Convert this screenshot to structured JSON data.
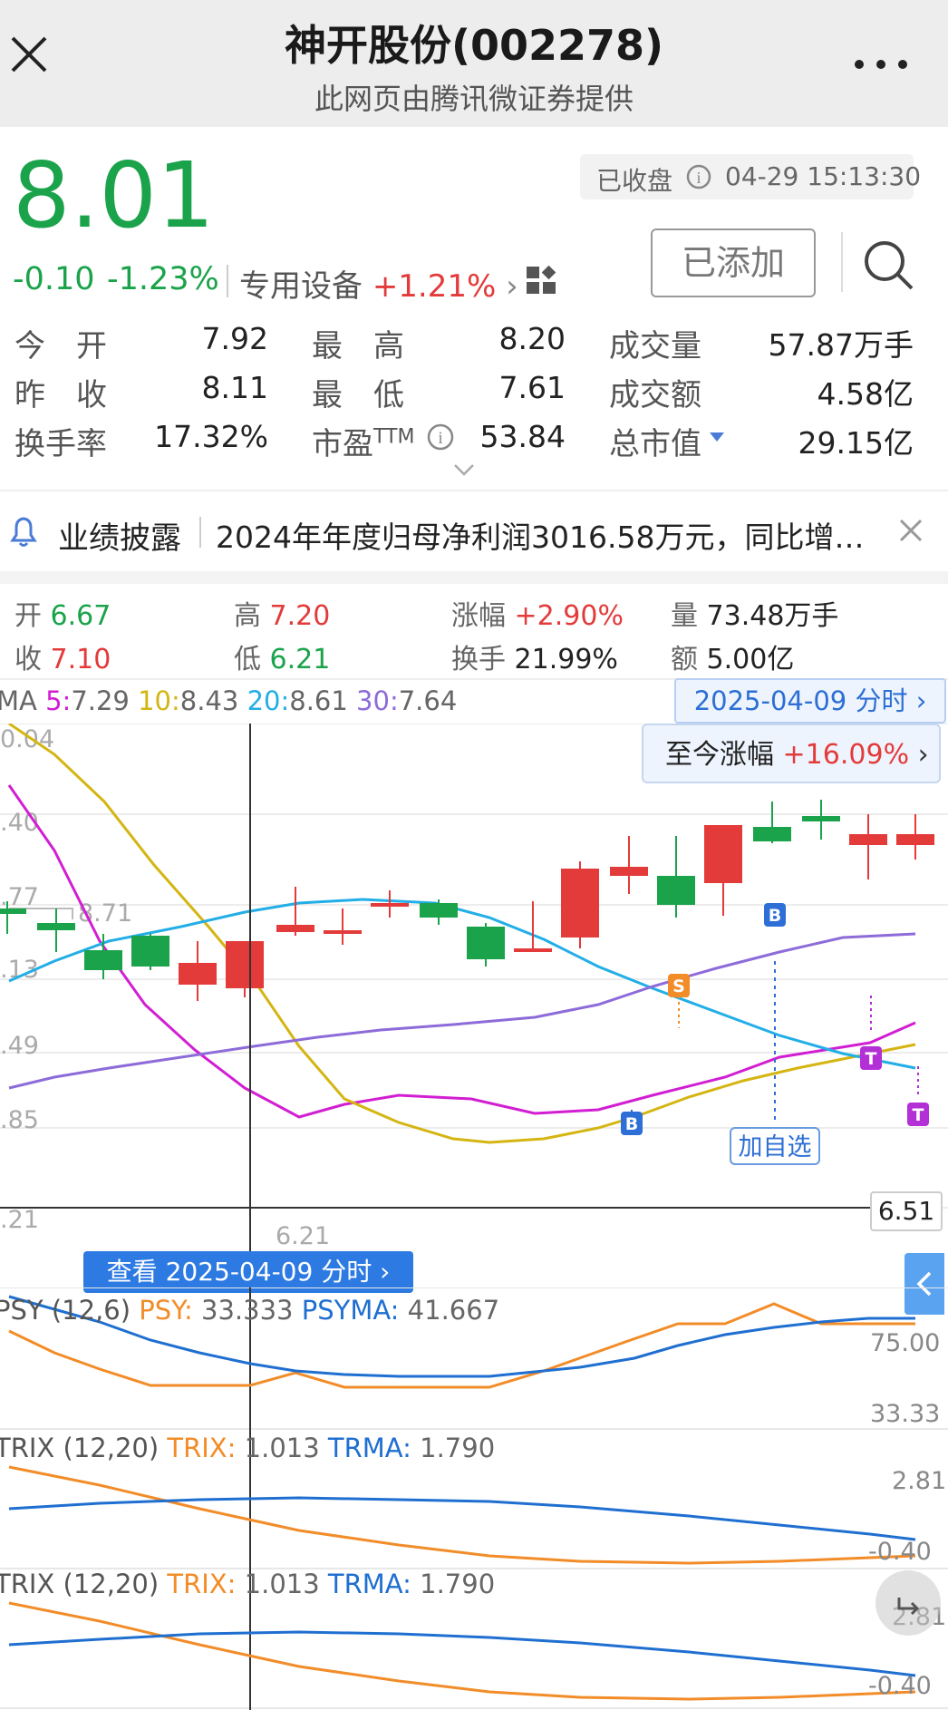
{
  "header": {
    "title": "神开股份(002278)",
    "subtitle": "此网页由腾讯微证券提供"
  },
  "quote": {
    "price": "8.01",
    "change": "-0.10",
    "change_pct": "-1.23%",
    "sector": "专用设备",
    "sector_pct": "+1.21%",
    "status": "已收盘",
    "time": "04-29 15:13:30",
    "added_label": "已添加"
  },
  "stats": [
    {
      "label": "今　开",
      "value": "7.92"
    },
    {
      "label": "最　高",
      "value": "8.20"
    },
    {
      "label": "成交量",
      "value": "57.87万手"
    },
    {
      "label": "昨　收",
      "value": "8.11"
    },
    {
      "label": "最　低",
      "value": "7.61"
    },
    {
      "label": "成交额",
      "value": "4.58亿"
    },
    {
      "label": "换手率",
      "value": "17.32%"
    },
    {
      "label": "市盈",
      "label_sup": "TTM",
      "value": "53.84"
    },
    {
      "label": "总市值",
      "value": "29.15亿"
    }
  ],
  "notice": {
    "tag": "业绩披露",
    "text": "2024年年度归母净利润3016.58万元，同比增…"
  },
  "day": {
    "open_label": "开",
    "open": "6.67",
    "high_label": "高",
    "high": "7.20",
    "chg_label": "涨幅",
    "chg": "+2.90%",
    "vol_label": "量",
    "vol": "73.48万手",
    "close_label": "收",
    "close": "7.10",
    "low_label": "低",
    "low": "6.21",
    "turn_label": "换手",
    "turn": "21.99%",
    "amt_label": "额",
    "amt": "5.00亿"
  },
  "ma": {
    "prefix": "MA",
    "k5": "5:",
    "v5": "7.29",
    "k10": "10:",
    "v10": "8.43",
    "k20": "20:",
    "v20": "8.61",
    "k30": "30:",
    "v30": "7.64"
  },
  "date_btn": "2025-04-09 分时",
  "since": {
    "label": "至今涨幅",
    "value": "+16.09%"
  },
  "axis": {
    "y": [
      "0.04",
      ".40",
      ".77",
      ".13",
      ".49",
      ".85",
      ".21"
    ],
    "hi_mark": "8.71",
    "lo_mark": "6.21",
    "cursor_price": "6.51"
  },
  "markers": {
    "b": "B",
    "s": "S",
    "t": "T",
    "add": "加自选"
  },
  "view_btn": "查看 2025-04-09 分时",
  "psy": {
    "name": "PSY",
    "params": "(12,6)",
    "k": "PSY:",
    "v": "33.333",
    "mk": "PSYMA:",
    "mv": "41.667",
    "ymax": "75.00",
    "ymin": "33.33"
  },
  "trix1": {
    "name": "TRIX",
    "params": "(12,20)",
    "k": "TRIX:",
    "v": "1.013",
    "mk": "TRMA:",
    "mv": "1.790",
    "ymax": "2.81",
    "ymin": "-0.40"
  },
  "trix2": {
    "name": "TRIX",
    "params": "(12,20)",
    "k": "TRIX:",
    "v": "1.013",
    "mk": "TRMA:",
    "mv": "1.790",
    "ymax": "2.81",
    "ymin": "-0.40"
  },
  "colors": {
    "up": "#e33a3a",
    "down": "#1aa34a",
    "ma5": "#d21ed2",
    "ma10": "#d4b512",
    "ma20": "#22aee6",
    "ma30": "#8d6bd9",
    "trix": "#f28c28",
    "trma": "#1f6fd1"
  }
}
